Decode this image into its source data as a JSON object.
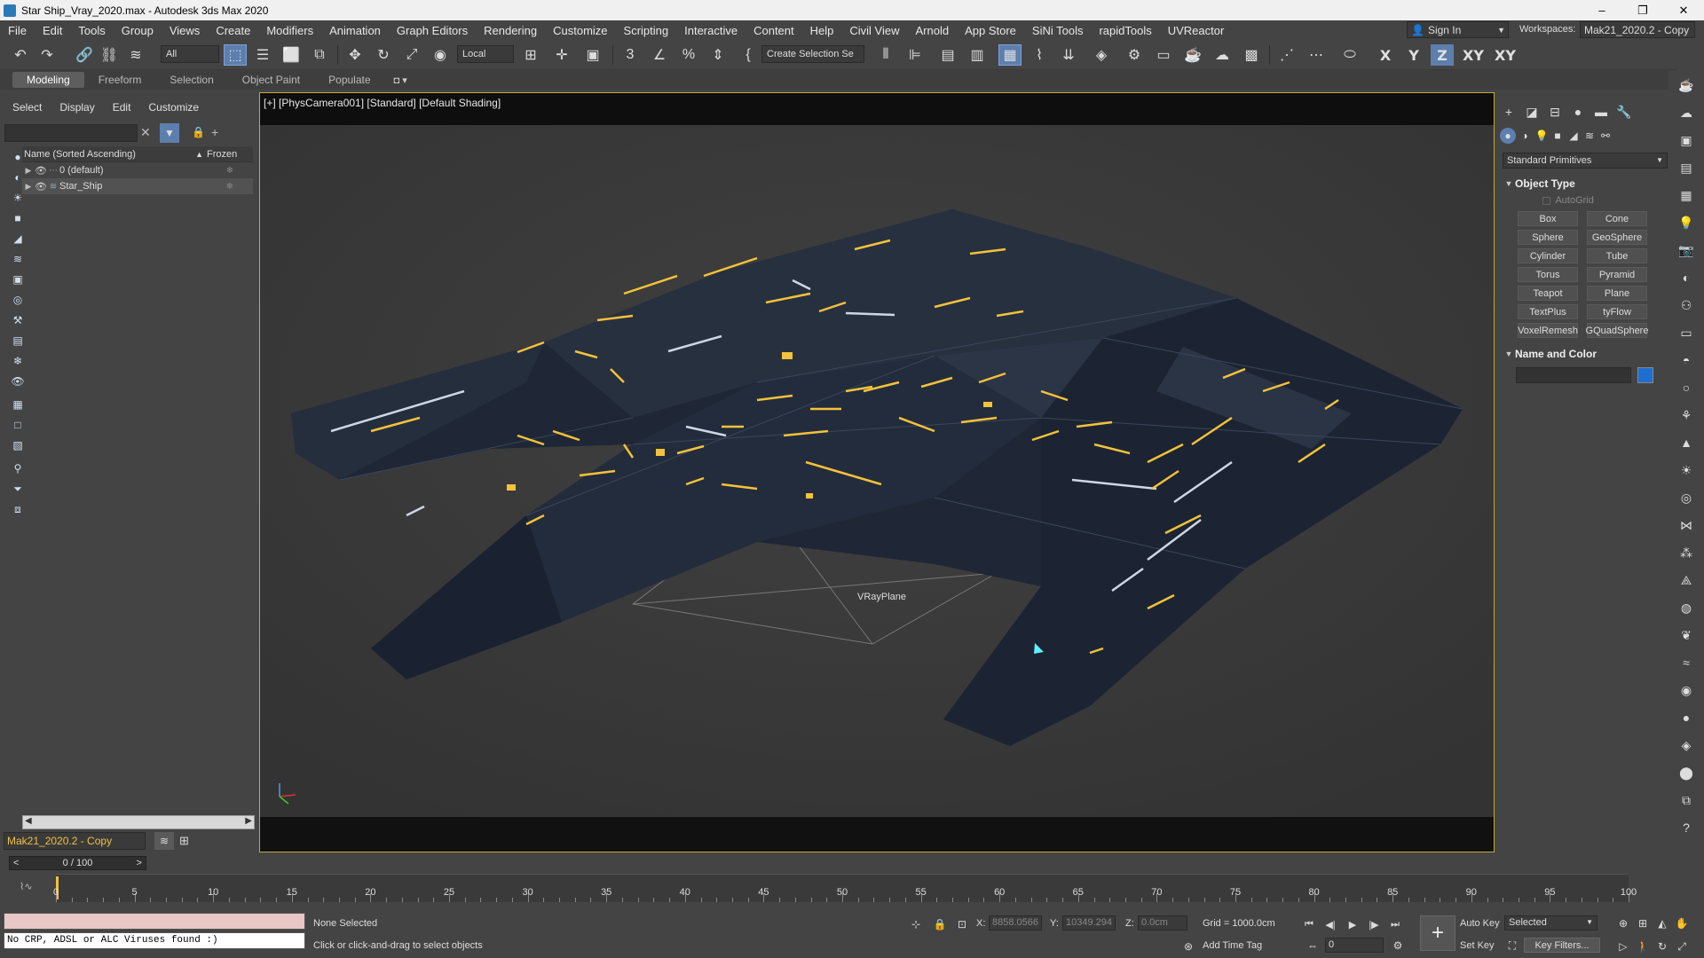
{
  "window": {
    "title": "Star Ship_Vray_2020.max - Autodesk 3ds Max 2020",
    "minimize": "–",
    "restore": "❐",
    "close": "✕"
  },
  "menu": [
    "File",
    "Edit",
    "Tools",
    "Group",
    "Views",
    "Create",
    "Modifiers",
    "Animation",
    "Graph Editors",
    "Rendering",
    "Customize",
    "Scripting",
    "Interactive",
    "Content",
    "Help",
    "Civil View",
    "Arnold",
    "App Store",
    "SiNi Tools",
    "rapidTools",
    "UVReactor"
  ],
  "account": {
    "sign_in": "Sign In",
    "workspaces_label": "Workspaces:",
    "workspace": "Mak21_2020.2 - Copy"
  },
  "toolbar": {
    "filter": "All",
    "coord_system": "Local",
    "selection_set": "Create Selection Se",
    "axes": [
      "X",
      "Y",
      "Z",
      "XY",
      "XY"
    ]
  },
  "ribbon_tabs": [
    "Modeling",
    "Freeform",
    "Selection",
    "Object Paint",
    "Populate"
  ],
  "explorer": {
    "menu": [
      "Select",
      "Display",
      "Edit",
      "Customize"
    ],
    "column_name": "Name (Sorted Ascending)",
    "column_frozen": "Frozen",
    "rows": [
      {
        "name": "0 (default)"
      },
      {
        "name": "Star_Ship"
      }
    ],
    "workspace": "Mak21_2020.2 - Copy"
  },
  "viewport": {
    "label": "[+] [PhysCamera001] [Standard] [Default Shading]",
    "vray_plane_label": "VRayPlane"
  },
  "command_panel": {
    "category": "Standard Primitives",
    "object_type_title": "Object Type",
    "autogrid": "AutoGrid",
    "buttons": [
      "Box",
      "Cone",
      "Sphere",
      "GeoSphere",
      "Cylinder",
      "Tube",
      "Torus",
      "Pyramid",
      "Teapot",
      "Plane",
      "TextPlus",
      "tyFlow",
      "VoxelRemesh",
      "GQuadSphere"
    ],
    "name_color_title": "Name and Color",
    "object_color": "#1e6fd2"
  },
  "timeline": {
    "slider": "0 / 100",
    "ticks": [
      "0",
      "5",
      "10",
      "15",
      "20",
      "25",
      "30",
      "35",
      "40",
      "45",
      "50",
      "55",
      "60",
      "65",
      "70",
      "75",
      "80",
      "85",
      "90",
      "95",
      "100"
    ]
  },
  "status": {
    "maxscript_output": "No CRP, ADSL or ALC Viruses found :)",
    "selection": "None Selected",
    "prompt": "Click or click-and-drag to select objects",
    "x_label": "X:",
    "x_value": "8858.0566",
    "y_label": "Y:",
    "y_value": "10349.294",
    "z_label": "Z:",
    "z_value": "0.0cm",
    "grid": "Grid = 1000.0cm",
    "add_time_tag": "Add Time Tag",
    "frame": "0",
    "auto_key": "Auto Key",
    "set_key": "Set Key",
    "selected": "Selected",
    "key_filters": "Key Filters..."
  }
}
